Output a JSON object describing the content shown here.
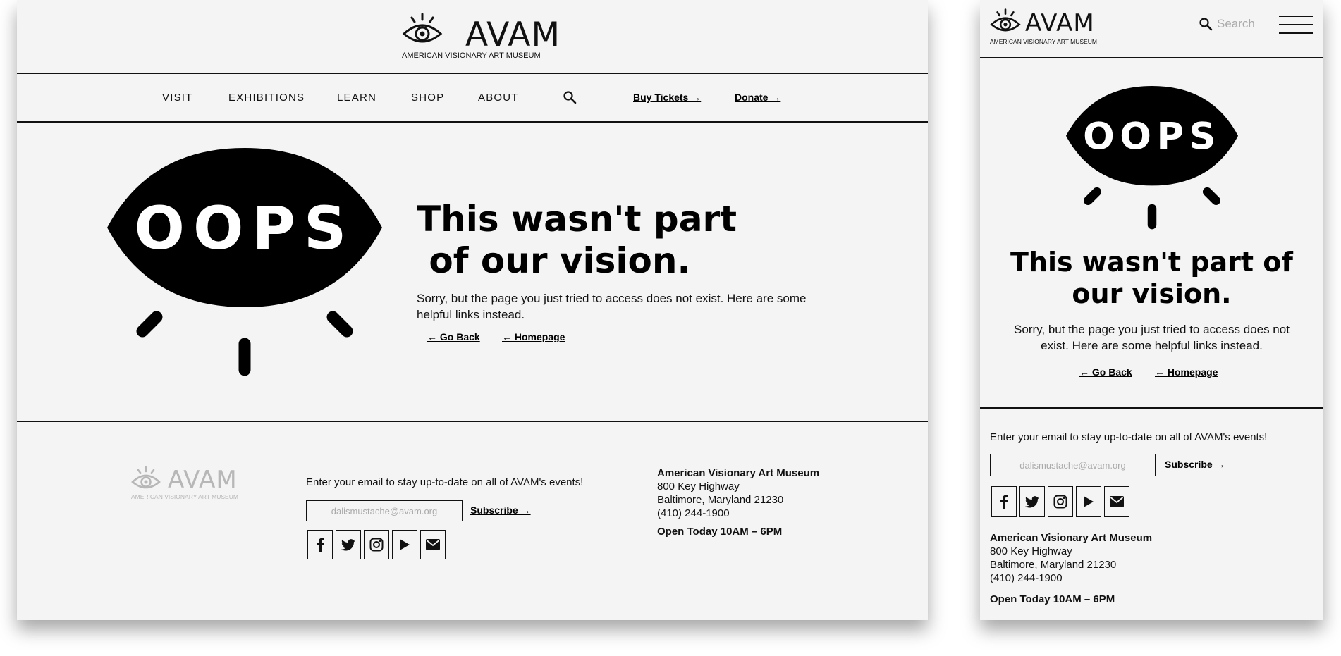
{
  "brand": {
    "name": "AVAM",
    "tagline": "AMERICAN VISIONARY ART MUSEUM"
  },
  "nav": {
    "items": [
      "VISIT",
      "EXHIBITIONS",
      "LEARN",
      "SHOP",
      "ABOUT"
    ],
    "buy_tickets": "Buy Tickets →",
    "donate": "Donate →"
  },
  "error": {
    "graphic_text": "OOPS",
    "heading": "This wasn't part of our vision.",
    "heading_line1": "This wasn't part",
    "heading_line2": " of our vision.",
    "message": "Sorry, but the page you just tried to access does not exist. Here are some helpful links instead.",
    "go_back": "← Go Back",
    "homepage": "← Homepage"
  },
  "mobile_header": {
    "search_placeholder": "Search"
  },
  "footer": {
    "subscribe_text": "Enter your email to stay up-to-date on all of AVAM's events!",
    "email_placeholder": "dalismustache@avam.org",
    "subscribe_label": "Subscribe →",
    "social": [
      "facebook-icon",
      "twitter-icon",
      "instagram-icon",
      "youtube-icon",
      "email-icon"
    ],
    "address": {
      "name": "American Visionary Art Museum",
      "street": "800 Key Highway",
      "city": "Baltimore, Maryland 21230",
      "phone": "(410) 244-1900"
    },
    "hours": "Open Today 10AM – 6PM"
  },
  "colors": {
    "background": "#f4f4f4",
    "ink": "#000000",
    "muted": "#b7b7b7"
  }
}
